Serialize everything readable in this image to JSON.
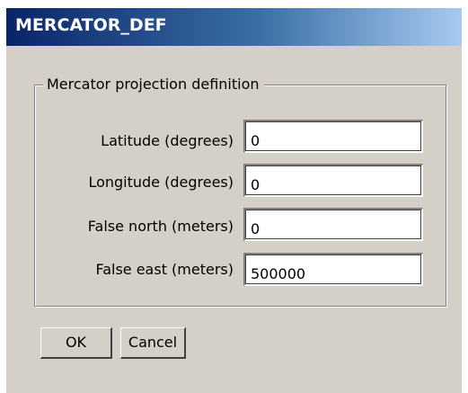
{
  "window": {
    "title": "MERCATOR_DEF"
  },
  "group": {
    "legend": "Mercator projection definition"
  },
  "fields": [
    {
      "label": "Latitude (degrees)",
      "value": "0"
    },
    {
      "label": "Longitude (degrees)",
      "value": "0"
    },
    {
      "label": "False north (meters)",
      "value": "0"
    },
    {
      "label": "False east (meters)",
      "value": "500000"
    }
  ],
  "buttons": {
    "ok_label": "OK",
    "cancel_label": "Cancel"
  },
  "colors": {
    "titlebar_start": "#0a246a",
    "titlebar_end": "#a6caf0",
    "dialog_background": "#d4d0c8"
  }
}
